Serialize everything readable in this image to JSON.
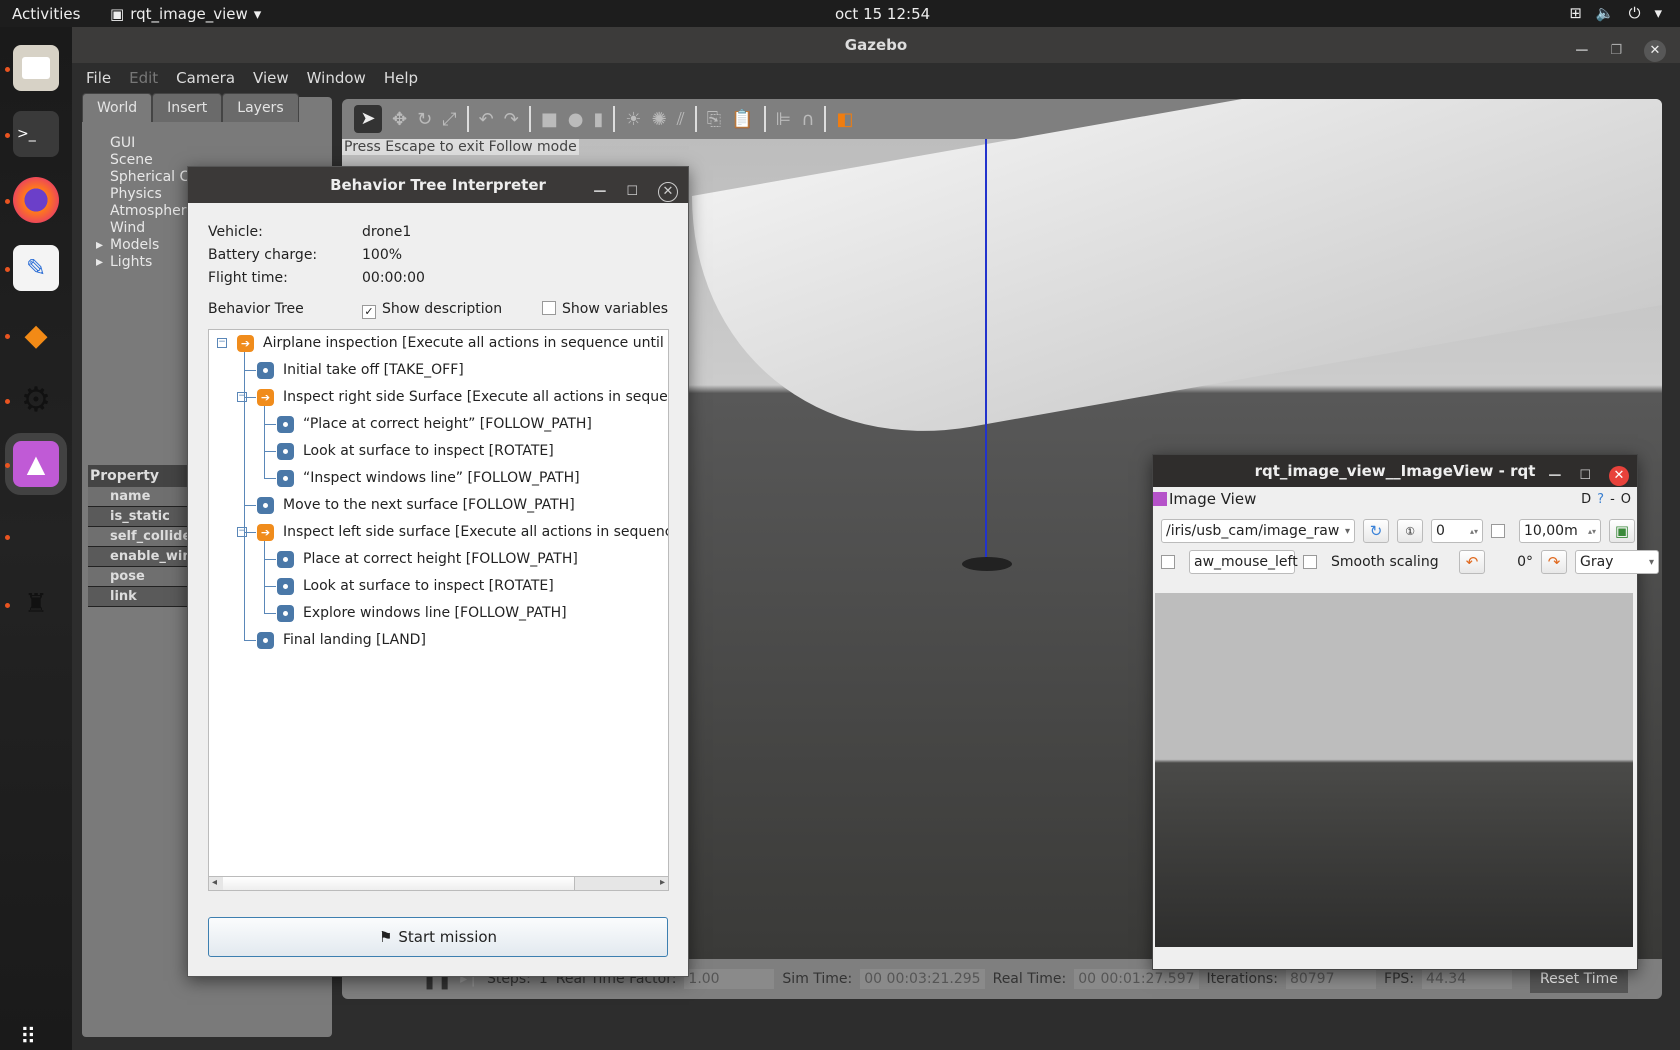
{
  "topbar": {
    "activities": "Activities",
    "app_name": "rqt_image_view",
    "clock": "oct 15  12:54"
  },
  "dock": {
    "items": [
      {
        "name": "files-icon",
        "glyph": "🗀"
      },
      {
        "name": "terminal-icon",
        "glyph": ">_"
      },
      {
        "name": "firefox-icon",
        "glyph": "🦊"
      },
      {
        "name": "text-editor-icon",
        "glyph": "✎"
      },
      {
        "name": "gazebo-icon",
        "glyph": "◆"
      },
      {
        "name": "settings-gears-icon",
        "glyph": "⚙"
      },
      {
        "name": "image-viewer-icon",
        "glyph": "▲"
      },
      {
        "name": "ros-icon",
        "glyph": "⚲"
      }
    ],
    "apps_grid": "⋮⋮⋮"
  },
  "gazebo": {
    "title": "Gazebo",
    "menu": [
      "File",
      "Edit",
      "Camera",
      "View",
      "Window",
      "Help"
    ],
    "tabs": [
      "World",
      "Insert",
      "Layers"
    ],
    "world_tree": [
      "GUI",
      "Scene",
      "Spherical Coordinates",
      "Physics",
      "Atmosphere",
      "Wind",
      "Models",
      "Lights"
    ],
    "property_header": "Property",
    "properties": [
      "name",
      "is_static",
      "self_collide",
      "enable_wind",
      "pose",
      "link"
    ],
    "follow_hint": "Press Escape to exit Follow mode",
    "status": {
      "steps_label": "Steps:",
      "steps_value": "1",
      "rtf_label": "Real Time Factor:",
      "rtf_value": "1.00",
      "sim_time_label": "Sim Time:",
      "sim_time_value": "00 00:03:21.295",
      "real_time_label": "Real Time:",
      "real_time_value": "00 00:01:27.597",
      "iterations_label": "Iterations:",
      "iterations_value": "80797",
      "fps_label": "FPS:",
      "fps_value": "44.34",
      "reset_label": "Reset Time"
    }
  },
  "bti": {
    "title": "Behavior Tree Interpreter",
    "vehicle_label": "Vehicle:",
    "vehicle_value": "drone1",
    "battery_label": "Battery charge:",
    "battery_value": "100%",
    "flight_label": "Flight time:",
    "flight_value": "00:00:00",
    "tree_label": "Behavior Tree",
    "show_description": "Show description",
    "show_description_checked": true,
    "show_variables": "Show variables",
    "show_variables_checked": false,
    "nodes": [
      {
        "label": "Airplane inspection [Execute all actions in sequence until one",
        "type": "sequence",
        "depth": 0
      },
      {
        "label": "Initial take off [TAKE_OFF]",
        "type": "action",
        "depth": 1
      },
      {
        "label": "Inspect right side Surface [Execute all actions in sequence",
        "type": "sequence",
        "depth": 1
      },
      {
        "label": "“Place at correct height” [FOLLOW_PATH]",
        "type": "action",
        "depth": 2
      },
      {
        "label": "Look at surface to inspect [ROTATE]",
        "type": "action",
        "depth": 2
      },
      {
        "label": "“Inspect windows line” [FOLLOW_PATH]",
        "type": "action",
        "depth": 2
      },
      {
        "label": "Move to the next surface [FOLLOW_PATH]",
        "type": "action",
        "depth": 1
      },
      {
        "label": "Inspect left side surface [Execute all actions in sequence u",
        "type": "sequence",
        "depth": 1
      },
      {
        "label": "Place at correct height [FOLLOW_PATH]",
        "type": "action",
        "depth": 2
      },
      {
        "label": "Look at surface to inspect [ROTATE]",
        "type": "action",
        "depth": 2
      },
      {
        "label": "Explore windows line [FOLLOW_PATH]",
        "type": "action",
        "depth": 2
      },
      {
        "label": "Final landing [LAND]",
        "type": "action",
        "depth": 1
      }
    ],
    "start_button": "Start mission"
  },
  "rqt": {
    "title": "rqt_image_view__ImageView - rqt",
    "plugin_title": "Image View",
    "topic": "/iris/usb_cam/image_raw",
    "spin_value": "0",
    "distance_value": "10,00m",
    "mouse_topic": "aw_mouse_left",
    "smooth_scaling": "Smooth scaling",
    "rotation": "0°",
    "color_scheme": "Gray"
  }
}
